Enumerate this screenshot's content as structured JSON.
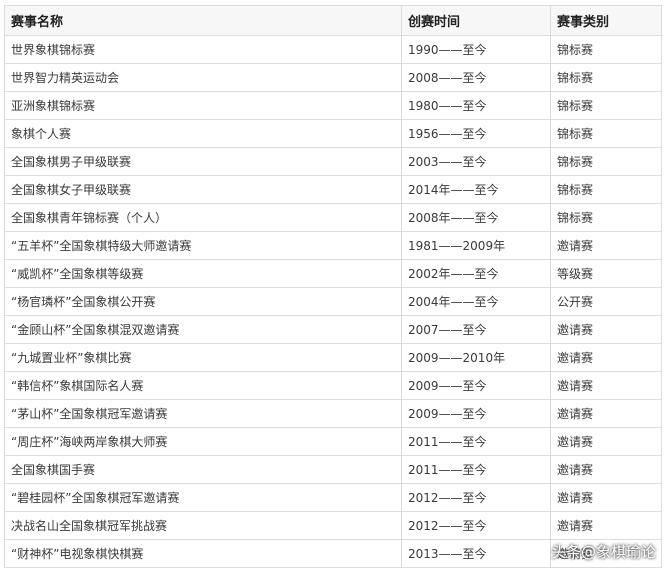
{
  "table": {
    "headers": [
      "赛事名称",
      "创赛时间",
      "赛事类别"
    ],
    "rows": [
      [
        "世界象棋锦标赛",
        "1990——至今",
        "锦标赛"
      ],
      [
        "世界智力精英运动会",
        "2008——至今",
        "锦标赛"
      ],
      [
        "亚洲象棋锦标赛",
        "1980——至今",
        "锦标赛"
      ],
      [
        "象棋个人赛",
        "1956——至今",
        "锦标赛"
      ],
      [
        "全国象棋男子甲级联赛",
        "2003——至今",
        "锦标赛"
      ],
      [
        "全国象棋女子甲级联赛",
        "2014年——至今",
        "锦标赛"
      ],
      [
        "全国象棋青年锦标赛（个人）",
        "2008年——至今",
        "锦标赛"
      ],
      [
        "“五羊杯”全国象棋特级大师邀请赛",
        "1981——2009年",
        "邀请赛"
      ],
      [
        "“威凯杯”全国象棋等级赛",
        "2002年——至今",
        "等级赛"
      ],
      [
        "“杨官璘杯”全国象棋公开赛",
        "2004年——至今",
        "公开赛"
      ],
      [
        "“金顾山杯”全国象棋混双邀请赛",
        "2007——至今",
        "邀请赛"
      ],
      [
        "“九城置业杯”象棋比赛",
        "2009——2010年",
        "邀请赛"
      ],
      [
        "“韩信杯”象棋国际名人赛",
        "2009——至今",
        "邀请赛"
      ],
      [
        "“茅山杯”全国象棋冠军邀请赛",
        "2009——至今",
        "邀请赛"
      ],
      [
        "“周庄杯”海峡两岸象棋大师赛",
        "2011——至今",
        "邀请赛"
      ],
      [
        "全国象棋国手赛",
        "2011——至今",
        "邀请赛"
      ],
      [
        "“碧桂园杯”全国象棋冠军邀请赛",
        "2012——至今",
        "邀请赛"
      ],
      [
        "决战名山全国象棋冠军挑战赛",
        "2012——至今",
        "邀请赛"
      ],
      [
        "“财神杯”电视象棋快棋赛",
        "2013——至今",
        "邀请赛"
      ]
    ]
  },
  "watermark": "头条@象棋瑜论"
}
